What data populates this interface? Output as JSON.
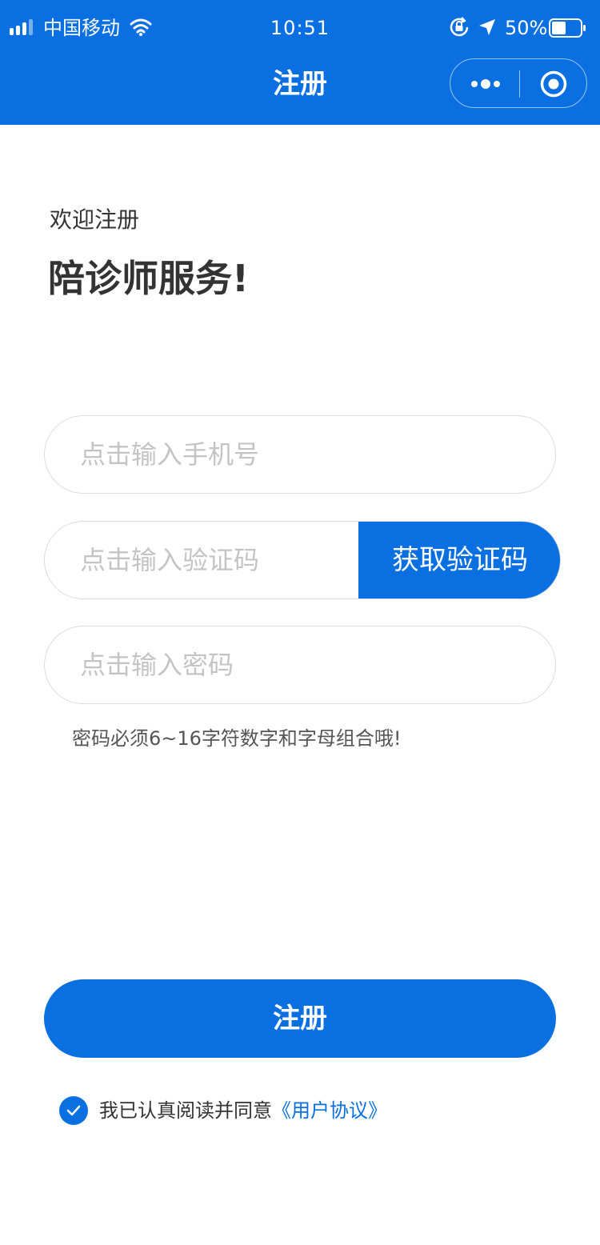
{
  "status_bar": {
    "carrier": "中国移动",
    "time": "10:51",
    "battery_percent": "50%",
    "battery_level": 0.5,
    "icons": [
      "signal-icon",
      "wifi-icon",
      "rotation-lock-icon",
      "location-arrow-icon",
      "battery-icon"
    ]
  },
  "nav": {
    "title": "注册",
    "capsule_icons": [
      "more-dots-icon",
      "close-circle-icon"
    ]
  },
  "welcome": {
    "label": "欢迎注册",
    "title": "陪诊师服务!"
  },
  "form": {
    "phone_placeholder": "点击输入手机号",
    "code_placeholder": "点击输入验证码",
    "get_code_label": "获取验证码",
    "password_placeholder": "点击输入密码",
    "password_hint": "密码必须6~16字符数字和字母组合哦!"
  },
  "actions": {
    "register_label": "注册"
  },
  "agreement": {
    "checked": true,
    "text": "我已认真阅读并同意",
    "link_text": "《用户协议》"
  },
  "colors": {
    "primary": "#0a6fe0",
    "text": "#333333",
    "placeholder": "#c4c4c4",
    "border": "#dcdcdc"
  }
}
